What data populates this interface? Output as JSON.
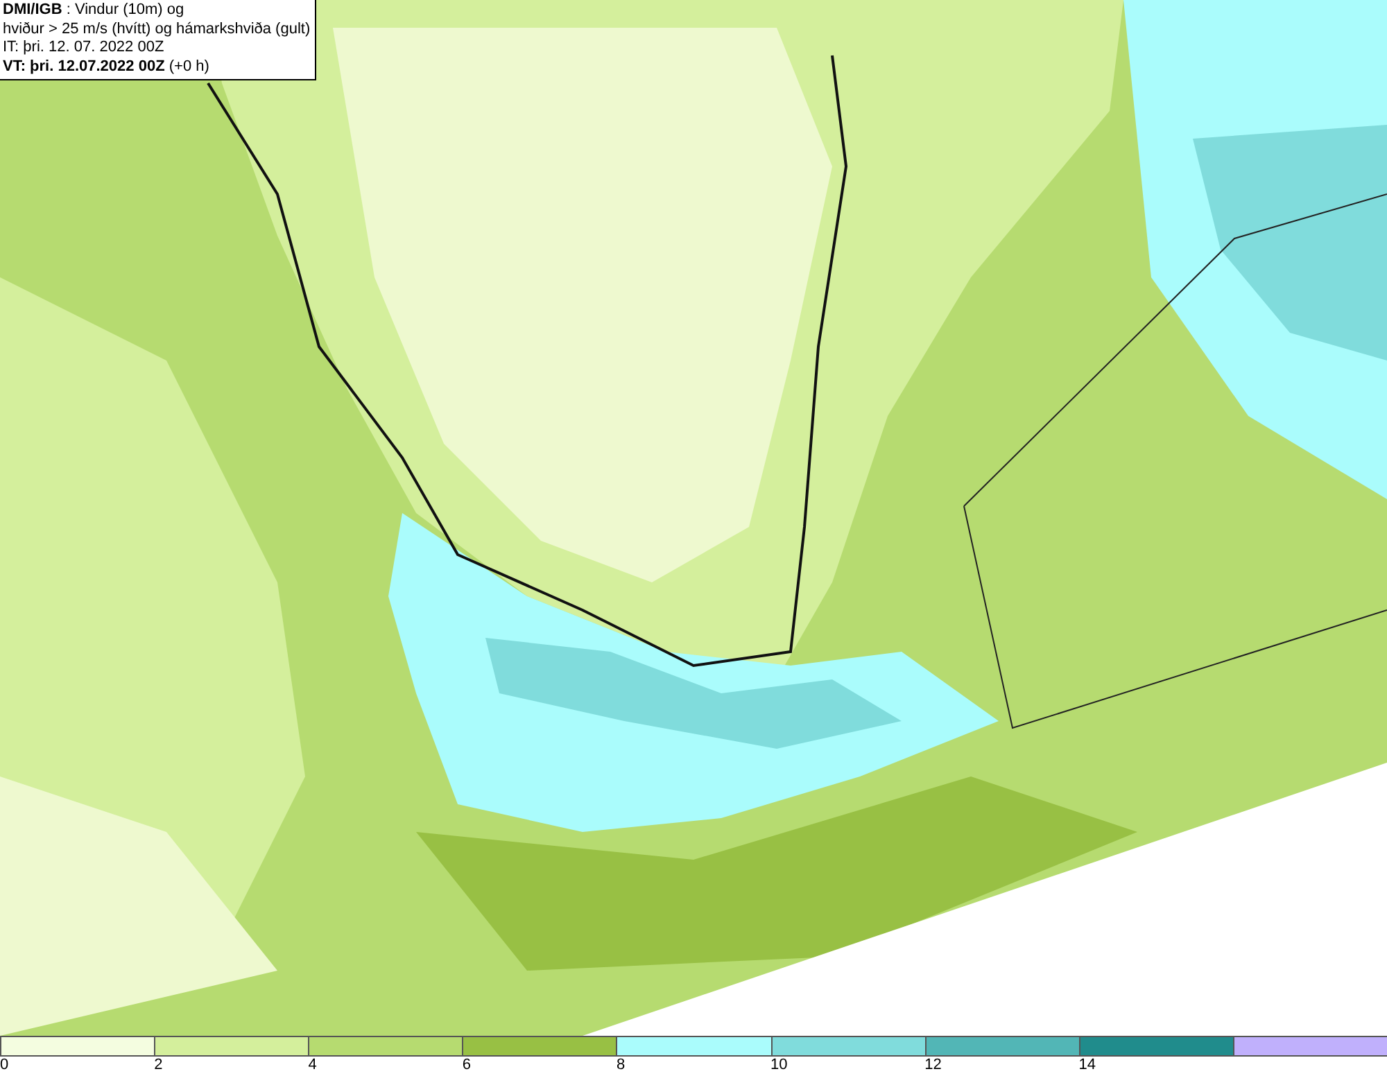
{
  "header": {
    "lines": [
      "**DMI/IGB** : Vindur (10m) og",
      "hviður > 25 m/s (hvítt) og hámarkshviða (gult)",
      "IT: þri. 12. 07. 2022 00Z",
      "**VT: þri. 12.07.2022 00Z** (+0 h)"
    ]
  },
  "legend": {
    "bins": [
      {
        "color": "#f4fde0",
        "label": "0"
      },
      {
        "color": "#d4ef9c",
        "label": "2"
      },
      {
        "color": "#b6db70",
        "label": "4"
      },
      {
        "color": "#98c044",
        "label": "6"
      },
      {
        "color": "#aafcfc",
        "label": "8"
      },
      {
        "color": "#80dcdc",
        "label": "10"
      },
      {
        "color": "#52b6b6",
        "label": "12"
      },
      {
        "color": "#208c8c",
        "label": "14"
      },
      {
        "color": "#c0b0fc"
      }
    ]
  }
}
